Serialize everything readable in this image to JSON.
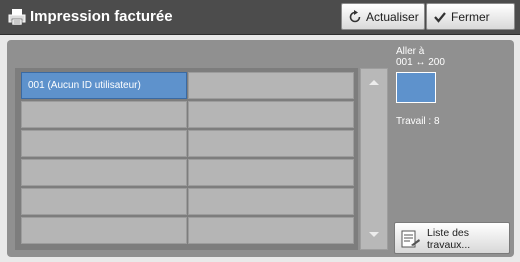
{
  "header": {
    "title": "Impression facturée",
    "refresh_label": "Actualiser",
    "close_label": "Fermer"
  },
  "table": {
    "rows": [
      [
        "001  (Aucun ID utilisateur)",
        ""
      ],
      [
        "",
        ""
      ],
      [
        "",
        ""
      ],
      [
        "",
        ""
      ],
      [
        "",
        ""
      ],
      [
        "",
        ""
      ]
    ]
  },
  "side": {
    "goto_line1": "Aller à",
    "goto_line2": "001 ↔ 200",
    "job_count": "Travail : 8",
    "list_label_line1": "Liste des",
    "list_label_line2": "travaux..."
  },
  "colors": {
    "titlebar": "#4c4c4c",
    "panel": "#909090",
    "selected": "#5e92cc"
  }
}
